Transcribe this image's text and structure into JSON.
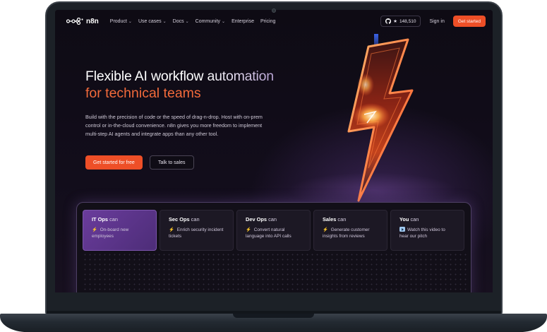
{
  "nav": {
    "logo_text": "n8n",
    "links": [
      {
        "label": "Product",
        "has_dropdown": true
      },
      {
        "label": "Use cases",
        "has_dropdown": true
      },
      {
        "label": "Docs",
        "has_dropdown": true
      },
      {
        "label": "Community",
        "has_dropdown": true
      },
      {
        "label": "Enterprise",
        "has_dropdown": false
      },
      {
        "label": "Pricing",
        "has_dropdown": false
      }
    ],
    "github_stars": "148,510",
    "sign_in": "Sign in",
    "get_started": "Get started"
  },
  "hero": {
    "title_part1": "Flexible AI workflow ",
    "title_part2": "automation",
    "title_line2": "for technical teams",
    "description": "Build with the precision of code or the speed of drag-n-drop. Host with on-prem control or in-the-cloud convenience. n8n gives you more freedom to implement multi-step AI agents and integrate apps than any other tool.",
    "primary_button": "Get started for free",
    "secondary_button": "Talk to sales"
  },
  "cards": [
    {
      "role": "IT Ops",
      "can": "can",
      "icon": "lightning-icon",
      "text": "On-board new employees",
      "active": true
    },
    {
      "role": "Sec Ops",
      "can": "can",
      "icon": "lightning-icon",
      "text": "Enrich security incident tickets",
      "active": false
    },
    {
      "role": "Dev Ops",
      "can": "can",
      "icon": "lightning-icon",
      "text": "Convert natural language into API calls",
      "active": false
    },
    {
      "role": "Sales",
      "can": "can",
      "icon": "lightning-icon",
      "text": "Generate customer insights from reviews",
      "active": false
    },
    {
      "role": "You",
      "can": "can",
      "icon": "play-icon",
      "text": "Watch this video to hear our pitch",
      "active": false
    }
  ],
  "colors": {
    "accent_orange": "#ee4f27",
    "title_orange": "#f26a3b",
    "active_card_purple": "#6a3c9c",
    "background": "#0d0a12"
  }
}
